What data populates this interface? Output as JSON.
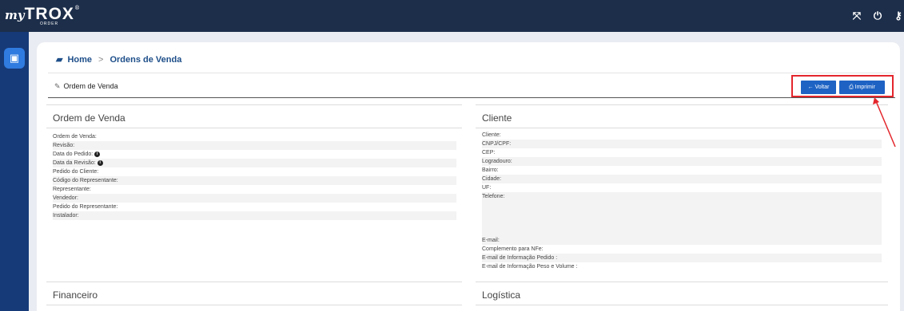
{
  "app": {
    "logo_prefix": "my",
    "logo_brand": "TROX",
    "logo_reg": "®",
    "logo_sub": "ORDER",
    "colors": {
      "topbar": "#1c2e4a",
      "sidebar": "#163a78",
      "primary": "#1e63c4",
      "highlight": "#e3262c"
    }
  },
  "topbar": {
    "icons": [
      "expand-icon",
      "power-icon",
      "key-icon"
    ]
  },
  "sidebar": {
    "icon": "briefcase-icon"
  },
  "breadcrumb": {
    "home": "Home",
    "separator": ">",
    "current": "Ordens de Venda"
  },
  "header": {
    "title": "Ordem de Venda",
    "back_label": "Voltar",
    "print_label": "Imprimir"
  },
  "ordem": {
    "title": "Ordem de Venda",
    "fields": [
      "Ordem de Venda:",
      "Revisão:",
      "Data do Pedido:",
      "Data da Revisão:",
      "Pedido do Cliente:",
      "Código do Representante:",
      "Representante:",
      "Vendedor:",
      "Pedido do Representante:",
      "Instalador:"
    ]
  },
  "cliente": {
    "title": "Cliente",
    "fields": [
      "Cliente:",
      "CNPJ/CPF:",
      "CEP:",
      "Logradouro:",
      "Bairro:",
      "Cidade:",
      "UF:",
      "Telefone:",
      "E-mail:",
      "Complemento para NFe:",
      "E-mail de Informação Pedido :",
      "E-mail de Informação Peso e Volume :"
    ]
  },
  "financeiro": {
    "title": "Financeiro"
  },
  "logistica": {
    "title": "Logística"
  }
}
